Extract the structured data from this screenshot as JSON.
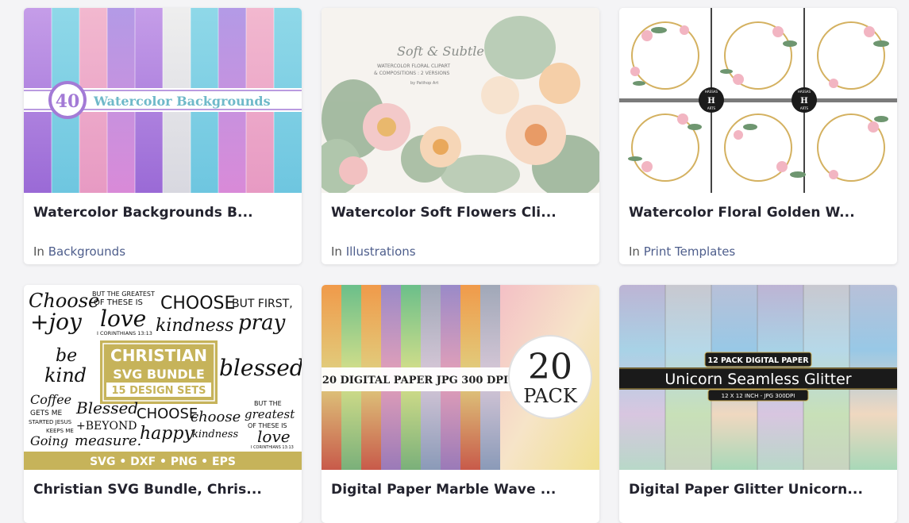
{
  "cards": [
    {
      "title": "Watercolor Backgrounds B...",
      "category_prefix": "In",
      "category": "Backgrounds",
      "image_text": {
        "count": "40",
        "label": "Watercolor Backgrounds"
      }
    },
    {
      "title": "Watercolor Soft Flowers Cli...",
      "category_prefix": "In",
      "category": "Illustrations",
      "image_text": {
        "script": "Soft & Subtle",
        "line1": "WATERCOLOR FLORAL CLIPART",
        "line2": "& COMPOSITIONS : 2 VERSIONS",
        "author": "by Patihop Art"
      }
    },
    {
      "title": "Watercolor Floral Golden W...",
      "category_prefix": "In",
      "category": "Print Templates",
      "image_text": {
        "badge_top": "HASSAS",
        "badge_letter": "H",
        "badge_bottom": "ARTS"
      }
    },
    {
      "title": "Christian SVG Bundle, Chris...",
      "category_prefix": "In",
      "category": "",
      "image_text": {
        "w_choose_joy_1": "Choose",
        "w_choose_joy_2": "+joy",
        "w_greatest_1": "BUT THE GREATEST",
        "w_greatest_2": "OF THESE IS",
        "w_greatest_3": "love",
        "w_greatest_4": "I CORINTHIANS 13:13",
        "w_kind_1": "CHOOSE",
        "w_kind_2": "kindness",
        "w_pray_1": "BUT FIRST,",
        "w_pray_2": "pray",
        "w_bekind_1": "be",
        "w_bekind_2": "kind",
        "w_blessed": "blessed",
        "box_1": "CHRISTIAN",
        "box_2": "SVG BUNDLE",
        "box_3": "15 DESIGN SETS",
        "w_coffee_1": "Coffee",
        "w_coffee_2": "GETS ME",
        "w_coffee_3": "STARTED JESUS",
        "w_coffee_4": "KEEPS ME",
        "w_coffee_5": "Going",
        "w_blessed2_1": "Blessed",
        "w_blessed2_2": "+BEYOND",
        "w_blessed2_3": "measure.",
        "w_happy_1": "CHOOSE",
        "w_happy_2": "happy",
        "w_kind2_1": "choose",
        "w_kind2_2": "kindness",
        "w_greatest2_1": "BUT THE",
        "w_greatest2_2": "greatest",
        "w_greatest2_3": "OF THESE IS",
        "w_greatest2_4": "love",
        "w_greatest2_5": "I CORINTHIANS 13:13",
        "footer": "SVG • DXF • PNG • EPS"
      }
    },
    {
      "title": "Digital Paper Marble Wave ...",
      "category_prefix": "",
      "category": "",
      "image_text": {
        "banner": "20 DIGITAL PAPER JPG 300 DPI",
        "num": "20",
        "word": "PACK"
      }
    },
    {
      "title": "Digital Paper Glitter Unicorn...",
      "category_prefix": "",
      "category": "",
      "image_text": {
        "pack": "12 PACK DIGITAL PAPER",
        "name": "Unicorn Seamless Glitter",
        "size": "12 X 12 INCH - JPG 300DPI"
      }
    }
  ],
  "colors": {
    "page_bg": "#f4f4f6",
    "title": "#23232e",
    "category_link": "#4e5e8c",
    "bundle_gold": "#c6b35a"
  }
}
